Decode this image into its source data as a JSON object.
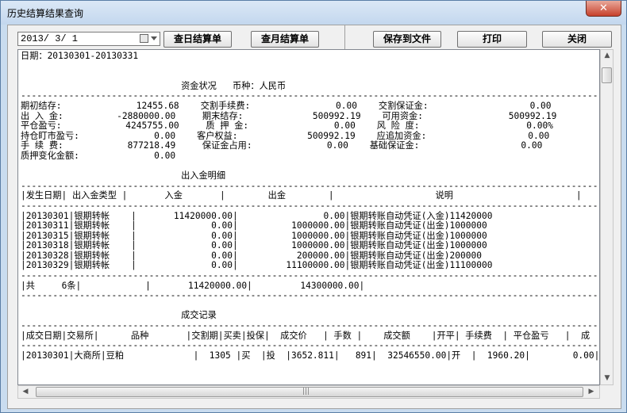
{
  "window": {
    "title": "历史结算结果查询",
    "close_glyph": "✕"
  },
  "toolbar": {
    "date_value": "2013/ 3/ 1",
    "btn_daily": "查日结算单",
    "btn_monthly": "查月结算单",
    "btn_save": "保存到文件",
    "btn_print": "打印",
    "btn_close": "关闭"
  },
  "report": {
    "text": "日期：20130301-20130331\n\n\n                              资金状况   币种：人民币\n--------------------------------------------------------------------------------------------------------------------------------------\n期初结存:              12455.68    交割手续费:                0.00    交割保证金:                   0.00\n出 入 金:          -2880000.00     期末结存:             500992.19    可用资金:                500992.19\n平仓盈亏:            4245755.00     质 押 金:                0.00    风 险 度:                    0.00%\n持仓盯市盈亏:              0.00    客户权益:             500992.19    应追加资金:                   0.00\n手 续 费:            877218.49     保证金占用:              0.00    基础保证金:                   0.00\n质押变化金额:              0.00\n\n                              出入金明细\n--------------------------------------------------------------------------------------------------------------------------------------\n|发生日期| 出入金类型 |       入金       |        出金        |                   说明                       |\n--------------------------------------------------------------------------------------------------------------------------------------\n|20130301|银期转帐    |       11420000.00|                0.00|银期转账自动凭证(入金)11420000\n|20130311|银期转帐    |              0.00|          1000000.00|银期转账自动凭证(出金)1000000\n|20130315|银期转帐    |              0.00|          1000000.00|银期转账自动凭证(出金)1000000\n|20130318|银期转帐    |              0.00|          1000000.00|银期转账自动凭证(出金)1000000\n|20130328|银期转帐    |              0.00|           200000.00|银期转账自动凭证(出金)200000\n|20130329|银期转帐    |              0.00|         11100000.00|银期转账自动凭证(出金)11100000\n--------------------------------------------------------------------------------------------------------------------------------------\n|共     6条|            |       11420000.00|         14300000.00|\n--------------------------------------------------------------------------------------------------------------------------------------\n\n                              成交记录\n--------------------------------------------------------------------------------------------------------------------------------------\n|成交日期|交易所|      品种       |交割期|买卖|投保|  成交价   | 手数 |    成交额    |开平| 手续费  | 平仓盈亏   |  成\n--------------------------------------------------------------------------------------------------------------------------------------\n|20130301|大商所|豆粕             |  1305 |买  |投  |3652.811|   891|  32546550.00|开  |  1960.20|        0.00|"
  },
  "scrollbar": {
    "up": "▲",
    "down": "▼",
    "left": "◀",
    "right": "▶",
    "grip": "|||"
  }
}
